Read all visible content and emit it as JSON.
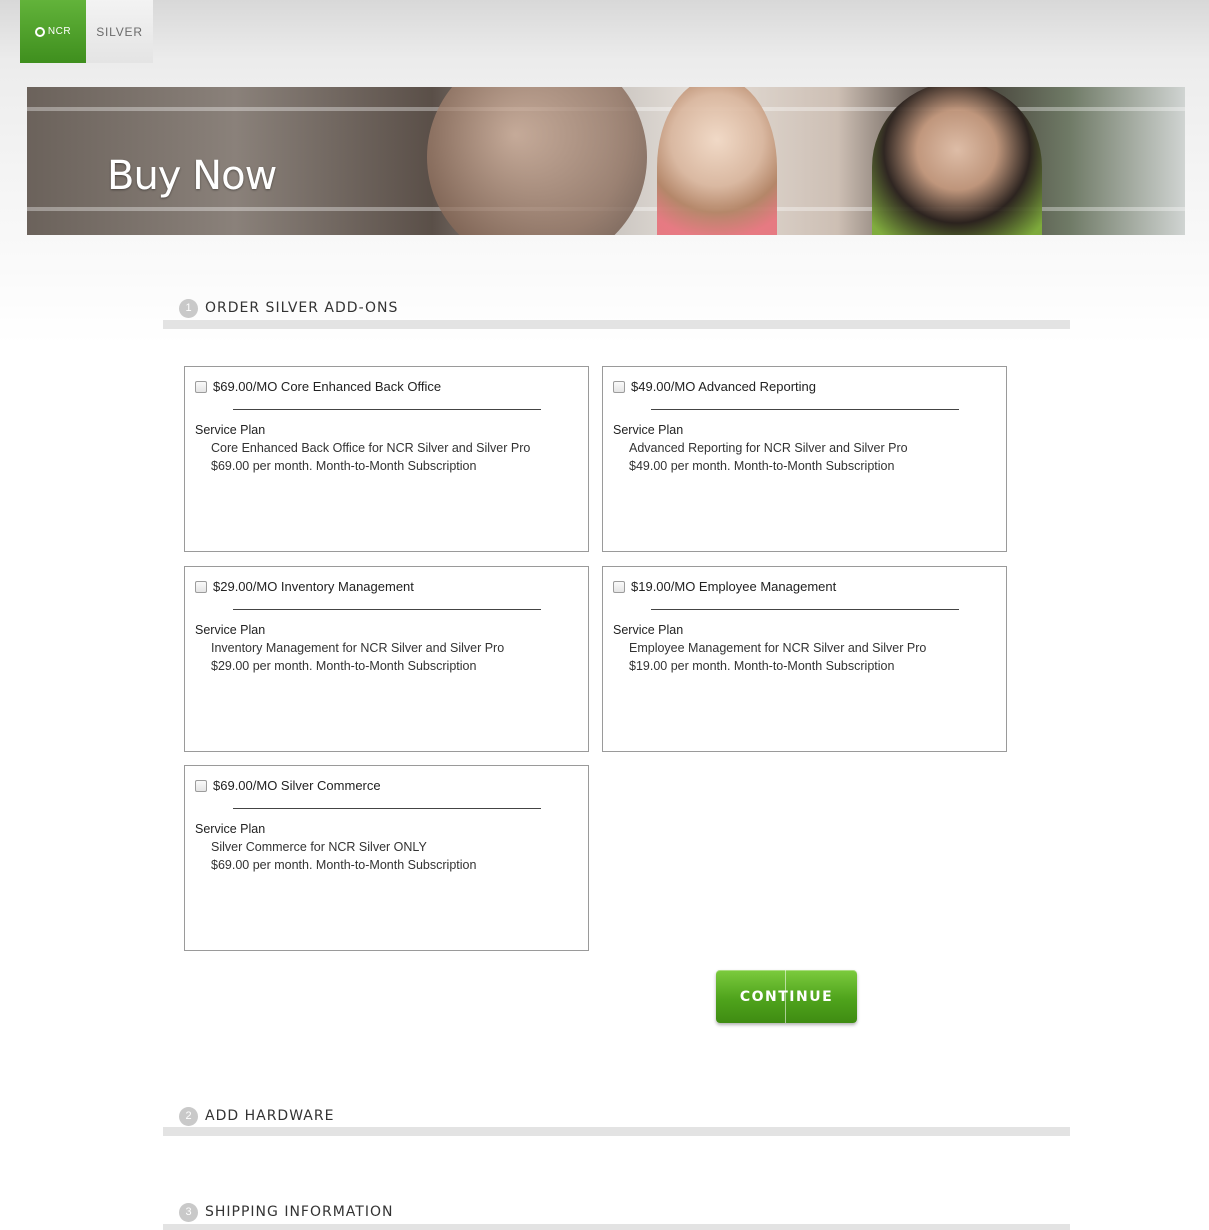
{
  "brand": {
    "ncr": "NCR",
    "silver": "SILVER"
  },
  "banner": {
    "title": "Buy Now"
  },
  "steps": [
    {
      "num": "1",
      "label": "ORDER SILVER ADD-ONS"
    },
    {
      "num": "2",
      "label": "ADD HARDWARE"
    },
    {
      "num": "3",
      "label": "SHIPPING INFORMATION"
    }
  ],
  "addons": [
    {
      "title": "$69.00/MO Core Enhanced Back Office",
      "plan": "Service Plan",
      "desc": "Core Enhanced Back Office for NCR Silver and Silver Pro",
      "price": "$69.00 per month. Month-to-Month Subscription",
      "checked": false
    },
    {
      "title": "$49.00/MO Advanced Reporting",
      "plan": "Service Plan",
      "desc": "Advanced Reporting for NCR Silver and Silver Pro",
      "price": "$49.00 per month. Month-to-Month Subscription",
      "checked": false
    },
    {
      "title": "$29.00/MO Inventory Management",
      "plan": "Service Plan",
      "desc": "Inventory Management for NCR Silver and Silver Pro",
      "price": "$29.00 per month. Month-to-Month Subscription",
      "checked": false
    },
    {
      "title": "$19.00/MO Employee Management",
      "plan": "Service Plan",
      "desc": "Employee Management for NCR Silver and Silver Pro",
      "price": "$19.00 per month. Month-to-Month Subscription",
      "checked": false
    },
    {
      "title": "$69.00/MO Silver Commerce",
      "plan": "Service Plan",
      "desc": "Silver Commerce for NCR Silver ONLY",
      "price": "$69.00 per month. Month-to-Month Subscription",
      "checked": false
    }
  ],
  "continue_label": "CONTINUE",
  "colors": {
    "accent": "#4fa31c",
    "brand_green": "#62b33a"
  }
}
